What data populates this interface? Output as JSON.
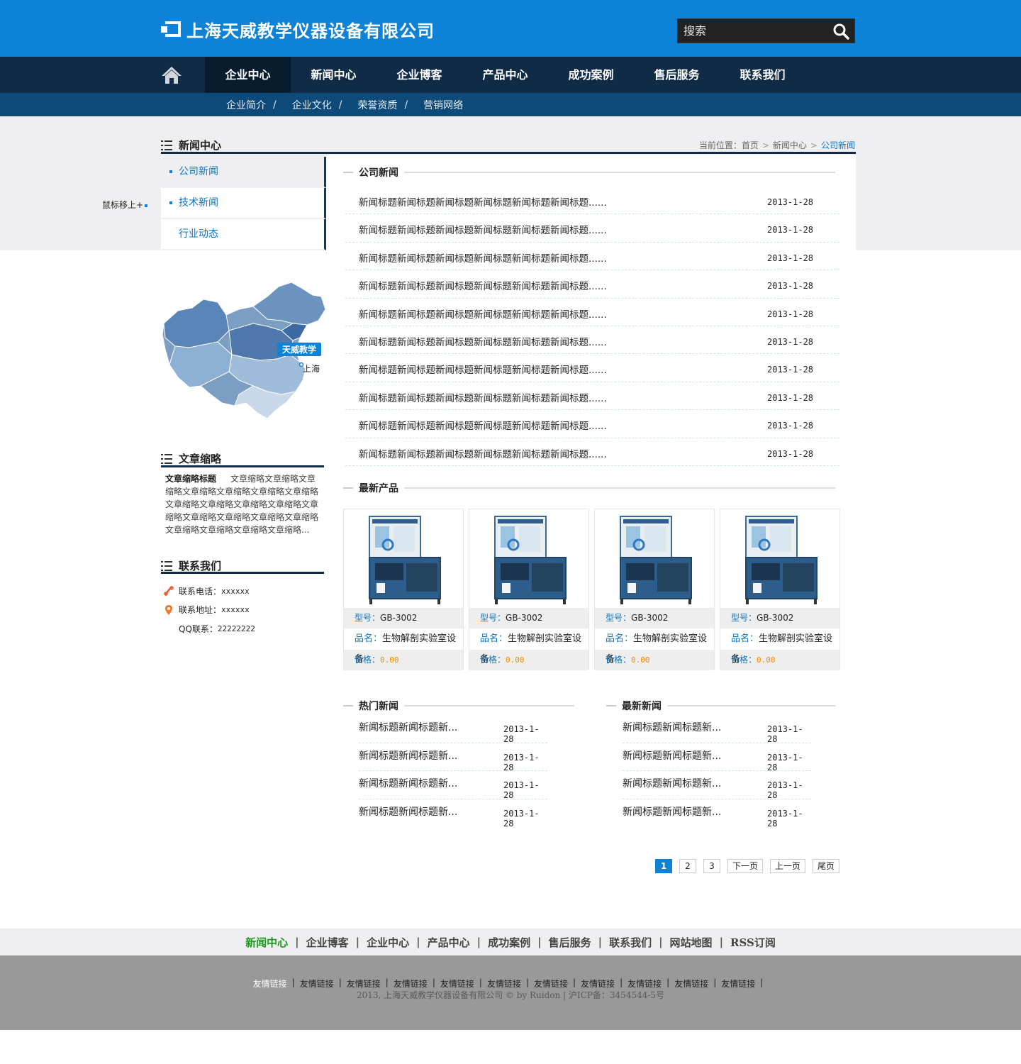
{
  "header": {
    "title": "上海天威教学仪器设备有限公司",
    "search_placeholder": "搜索"
  },
  "nav": {
    "items": [
      "企业中心",
      "新闻中心",
      "企业博客",
      "产品中心",
      "成功案例",
      "售后服务",
      "联系我们"
    ],
    "active": 0
  },
  "subnav": {
    "items": [
      "企业简介",
      "企业文化",
      "荣誉资质",
      "营销网络"
    ],
    "separator": "/"
  },
  "hint": "鼠标移上+",
  "left": {
    "section_title": "新闻中心",
    "menu": [
      "公司新闻",
      "技术新闻",
      "行业动态"
    ],
    "map_tag": "天威教学",
    "map_city": "上海",
    "summary_title": "文章缩略",
    "summary_heading": "文章缩略标题",
    "summary_text": "文章缩略文章缩略文章缩略文章缩略文章缩略文章缩略文章缩略文章缩略文章缩略文章缩略文章缩略文章缩略文章缩略文章缩略文章缩略文章缩略文章缩略文章缩略文章缩略文章缩略...",
    "contact_title": "联系我们",
    "contact": {
      "phone_label": "联系电话：",
      "phone": "xxxxxx",
      "addr_label": "联系地址：",
      "addr": "xxxxxx",
      "qq_label": "QQ联系：",
      "qq": "22222222"
    }
  },
  "breadcrumb": {
    "label": "当前位置：",
    "home": "首页",
    "news": "新闻中心",
    "current": "公司新闻",
    "sep": ">"
  },
  "company_news": {
    "title": "公司新闻",
    "items": [
      {
        "t": "新闻标题新闻标题新闻标题新闻标题新闻标题新闻标题......",
        "d": "2013-1-28"
      },
      {
        "t": "新闻标题新闻标题新闻标题新闻标题新闻标题新闻标题......",
        "d": "2013-1-28"
      },
      {
        "t": "新闻标题新闻标题新闻标题新闻标题新闻标题新闻标题......",
        "d": "2013-1-28"
      },
      {
        "t": "新闻标题新闻标题新闻标题新闻标题新闻标题新闻标题......",
        "d": "2013-1-28"
      },
      {
        "t": "新闻标题新闻标题新闻标题新闻标题新闻标题新闻标题......",
        "d": "2013-1-28"
      },
      {
        "t": "新闻标题新闻标题新闻标题新闻标题新闻标题新闻标题......",
        "d": "2013-1-28"
      },
      {
        "t": "新闻标题新闻标题新闻标题新闻标题新闻标题新闻标题......",
        "d": "2013-1-28"
      },
      {
        "t": "新闻标题新闻标题新闻标题新闻标题新闻标题新闻标题......",
        "d": "2013-1-28"
      },
      {
        "t": "新闻标题新闻标题新闻标题新闻标题新闻标题新闻标题......",
        "d": "2013-1-28"
      },
      {
        "t": "新闻标题新闻标题新闻标题新闻标题新闻标题新闻标题......",
        "d": "2013-1-28"
      }
    ]
  },
  "products": {
    "title": "最新产品",
    "items": [
      {
        "model_label": "型号：",
        "model": "GB-3002",
        "name_label": "品名：",
        "name": "生物解剖实验室设备",
        "price_label": "价格：",
        "price": "0.00"
      },
      {
        "model_label": "型号：",
        "model": "GB-3002",
        "name_label": "品名：",
        "name": "生物解剖实验室设备",
        "price_label": "价格：",
        "price": "0.00"
      },
      {
        "model_label": "型号：",
        "model": "GB-3002",
        "name_label": "品名：",
        "name": "生物解剖实验室设备",
        "price_label": "价格：",
        "price": "0.00"
      },
      {
        "model_label": "型号：",
        "model": "GB-3002",
        "name_label": "品名：",
        "name": "生物解剖实验室设备",
        "price_label": "价格：",
        "price": "0.00"
      }
    ]
  },
  "hot_news": {
    "title": "热门新闻",
    "items": [
      {
        "t": "新闻标题新闻标题新...",
        "d": "2013-1-28"
      },
      {
        "t": "新闻标题新闻标题新...",
        "d": "2013-1-28"
      },
      {
        "t": "新闻标题新闻标题新...",
        "d": "2013-1-28"
      },
      {
        "t": "新闻标题新闻标题新...",
        "d": "2013-1-28"
      }
    ]
  },
  "latest_news": {
    "title": "最新新闻",
    "items": [
      {
        "t": "新闻标题新闻标题新...",
        "d": "2013-1-28"
      },
      {
        "t": "新闻标题新闻标题新...",
        "d": "2013-1-28"
      },
      {
        "t": "新闻标题新闻标题新...",
        "d": "2013-1-28"
      },
      {
        "t": "新闻标题新闻标题新...",
        "d": "2013-1-28"
      }
    ]
  },
  "pager": {
    "pages": [
      "1",
      "2",
      "3"
    ],
    "current": "1",
    "next": "下一页",
    "prev": "上一页",
    "last": "尾页"
  },
  "footer": {
    "nav": [
      "新闻中心",
      "企业博客",
      "企业中心",
      "产品中心",
      "成功案例",
      "售后服务",
      "联系我们",
      "网站地图",
      "RSS订阅"
    ],
    "links": [
      "友情链接",
      "友情链接",
      "友情链接",
      "友情链接",
      "友情链接",
      "友情链接",
      "友情链接",
      "友情链接",
      "友情链接",
      "友情链接",
      "友情链接"
    ],
    "copyright": "2013, 上海天威教学仪器设备有限公司 © by Ruidon | 沪ICP备：3454544-5号"
  },
  "colors": {
    "header": "#0e82d6",
    "nav": "#0f2b45",
    "subnav": "#0d4a7a",
    "accent": "#0e74c0",
    "price": "#f08c00",
    "footer_active": "#1a9a1a"
  }
}
